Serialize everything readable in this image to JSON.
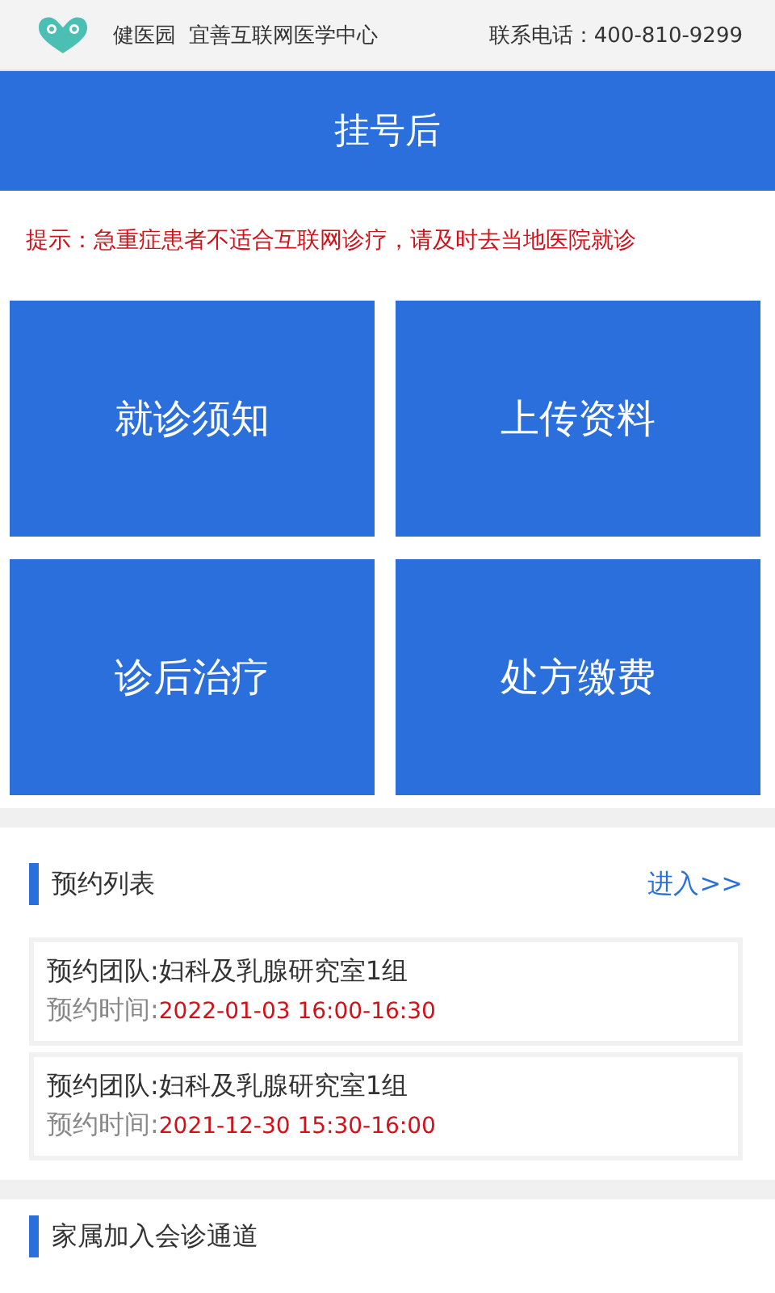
{
  "header": {
    "brand": "健医园",
    "center": "宜善互联网医学中心",
    "phone": "联系电话：400-810-9299"
  },
  "banner": {
    "title": "挂号后"
  },
  "notice": "提示：急重症患者不适合互联网诊疗，请及时去当地医院就诊",
  "tiles": [
    "就诊须知",
    "上传资料",
    "诊后治疗",
    "处方缴费"
  ],
  "appointments": {
    "title": "预约列表",
    "more": "进入>>",
    "items": [
      {
        "team_label": "预约团队:",
        "team": "妇科及乳腺研究室1组",
        "time_label": "预约时间:",
        "time": "2022-01-03 16:00-16:30"
      },
      {
        "team_label": "预约团队:",
        "team": "妇科及乳腺研究室1组",
        "time_label": "预约时间:",
        "time": "2021-12-30 15:30-16:00"
      }
    ]
  },
  "family": {
    "title": "家属加入会诊通道"
  }
}
